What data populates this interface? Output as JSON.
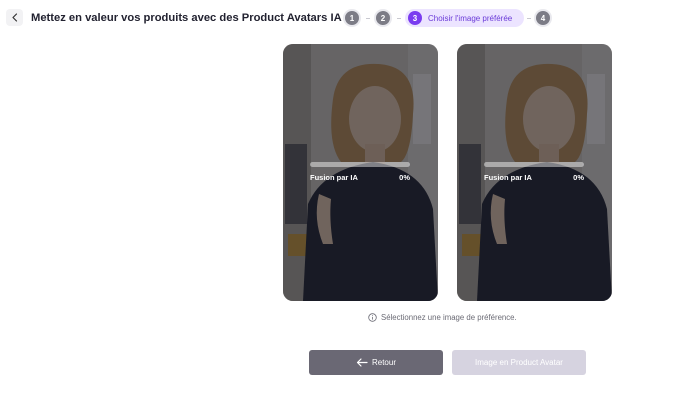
{
  "header": {
    "title": "Mettez en valeur vos produits avec des Product Avatars IA"
  },
  "stepper": {
    "steps": [
      {
        "number": "1",
        "state": "inactive"
      },
      {
        "number": "2",
        "state": "inactive"
      },
      {
        "number": "3",
        "state": "active",
        "label": "Choisir l'image préférée"
      },
      {
        "number": "4",
        "state": "inactive"
      }
    ],
    "accent_color": "#7a3cf0"
  },
  "cards": [
    {
      "status_label": "Fusion par IA",
      "progress_text": "0%",
      "progress": 0
    },
    {
      "status_label": "Fusion par IA",
      "progress_text": "0%",
      "progress": 0
    }
  ],
  "hint": {
    "icon": "info-icon",
    "text": "Sélectionnez une image de préférence."
  },
  "actions": {
    "back_label": "Retour",
    "back_icon": "arrow-left-icon",
    "primary_label": "Image en Product Avatar",
    "primary_enabled": false
  }
}
